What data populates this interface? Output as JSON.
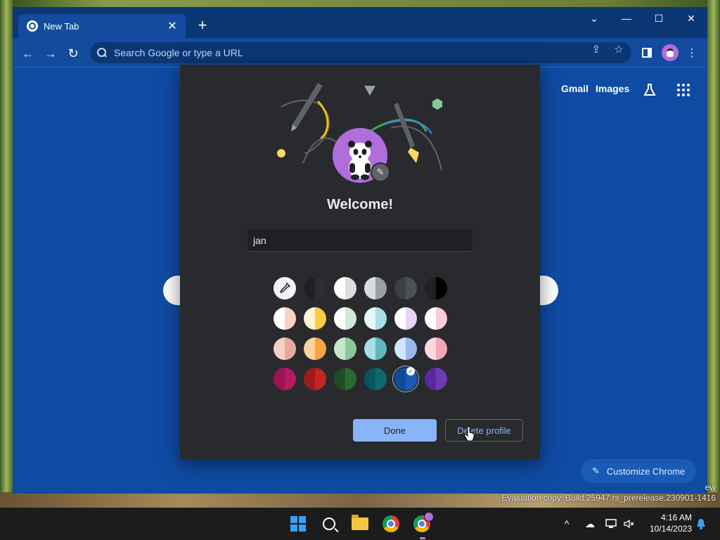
{
  "browser": {
    "tab_title": "New Tab",
    "tab_close": "✕",
    "new_tab": "+",
    "window_controls": {
      "tab_search": "⌄",
      "minimize": "—",
      "maximize": "☐",
      "close": "✕"
    },
    "omnibox_placeholder": "Search Google or type a URL",
    "nav": {
      "back": "←",
      "forward": "→",
      "reload": "↻"
    },
    "toolbar_icons": [
      "share-icon",
      "bookmark-star-icon",
      "side-panel-icon",
      "profile-avatar",
      "kebab-menu-icon"
    ]
  },
  "ntp": {
    "gmail": "Gmail",
    "images": "Images",
    "customize": "Customize Chrome",
    "partial_text": "ew"
  },
  "dialog": {
    "welcome": "Welcome!",
    "name_value": "jan",
    "done": "Done",
    "delete_profile": "Delete profile",
    "selected_color": "#1a5bb5",
    "color_rows": [
      [
        {
          "a": "#202124",
          "b": "#2c2e31"
        },
        {
          "a": "#ffffff",
          "b": "#dadce0"
        },
        {
          "a": "#dadce0",
          "b": "#9aa0a6"
        },
        {
          "a": "#3c4043",
          "b": "#4b5155"
        },
        {
          "a": "#202124",
          "b": "#000000"
        }
      ],
      [
        {
          "a": "#ffffff",
          "b": "#fbd1c4"
        },
        {
          "a": "#fff6d5",
          "b": "#fbcd44"
        },
        {
          "a": "#ffffff",
          "b": "#ceead6"
        },
        {
          "a": "#e6f7f8",
          "b": "#a8dee4"
        },
        {
          "a": "#ffffff",
          "b": "#e8d5f5"
        },
        {
          "a": "#ffffff",
          "b": "#f8ccd9"
        }
      ],
      [
        {
          "a": "#f3cfc4",
          "b": "#e6a99a"
        },
        {
          "a": "#fcd3a0",
          "b": "#f9a442"
        },
        {
          "a": "#c8e6c9",
          "b": "#8bc79a"
        },
        {
          "a": "#a8dee4",
          "b": "#5fb8bf"
        },
        {
          "a": "#d2e3fc",
          "b": "#9bb7ea"
        },
        {
          "a": "#fbd7de",
          "b": "#f4a7b5"
        }
      ],
      [
        {
          "a": "#9c1453",
          "b": "#b41b60"
        },
        {
          "a": "#a11b1b",
          "b": "#c2261f"
        },
        {
          "a": "#1d4f23",
          "b": "#2a6a31"
        },
        {
          "a": "#08575c",
          "b": "#0d6b70"
        },
        {
          "a": "#0d4c9d",
          "b": "#1a5bb5"
        },
        {
          "a": "#5a2a9c",
          "b": "#6e3bb5"
        }
      ]
    ]
  },
  "watermark": {
    "line": "Evaluation copy. Build 25947.rs_prerelease.230901-1416"
  },
  "taskbar": {
    "time": "4:16 AM",
    "date": "10/14/2023",
    "tray_chevron": "^"
  }
}
